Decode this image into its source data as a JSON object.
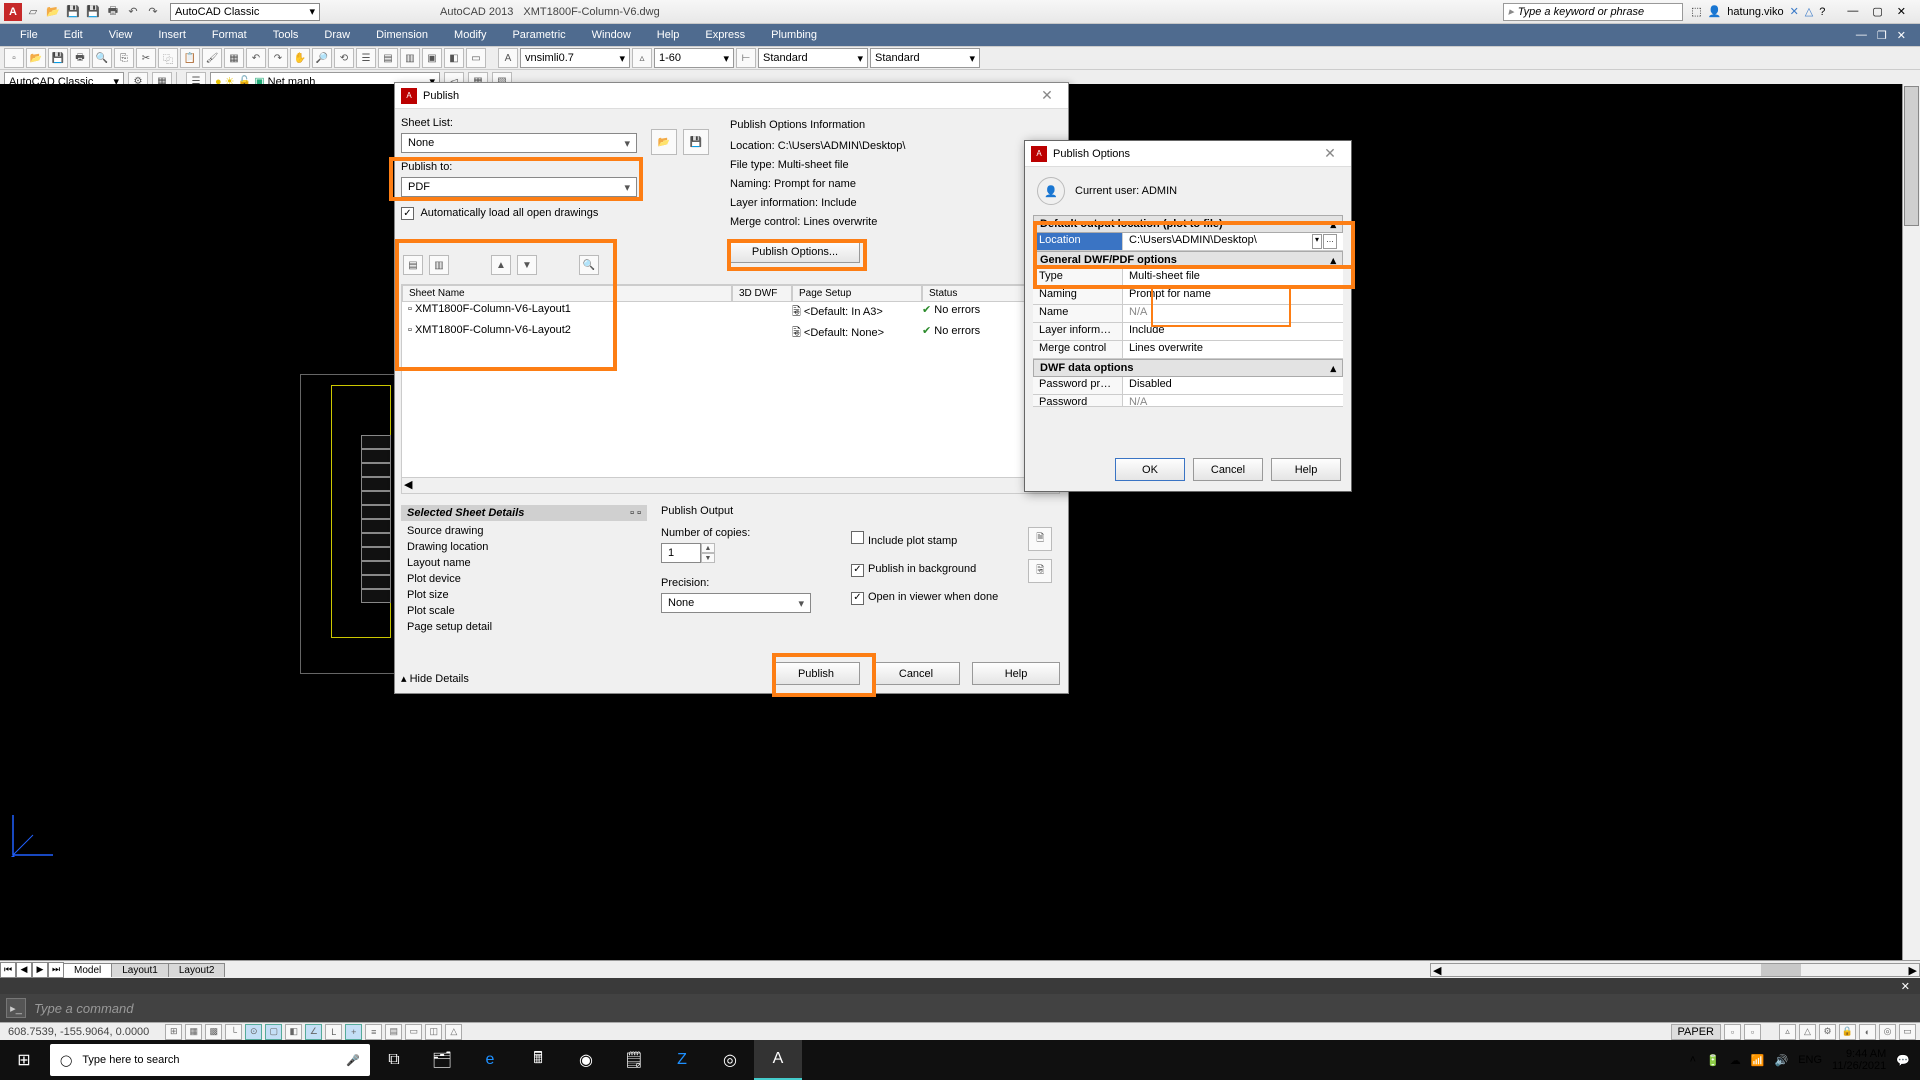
{
  "app": {
    "name": "AutoCAD 2013",
    "file": "XMT1800F-Column-V6.dwg",
    "workspace": "AutoCAD Classic",
    "search_placeholder": "Type a keyword or phrase",
    "user": "hatung.viko"
  },
  "menus": [
    "File",
    "Edit",
    "View",
    "Insert",
    "Format",
    "Tools",
    "Draw",
    "Dimension",
    "Modify",
    "Parametric",
    "Window",
    "Help",
    "Express",
    "Plumbing"
  ],
  "toolbar1": {
    "textstyle": "vnsimli0.7",
    "annoscale": "1-60",
    "dimstyle": "Standard",
    "tablestyle": "Standard"
  },
  "toolbar2": {
    "layer": "Net manh",
    "ws": "AutoCAD Classic"
  },
  "tabs": {
    "items": [
      "Model",
      "Layout1",
      "Layout2"
    ],
    "active": 0
  },
  "cmd": {
    "placeholder": "Type a command"
  },
  "status": {
    "coords": "608.7539, -155.9064, 0.0000",
    "paper": "PAPER"
  },
  "publish": {
    "title": "Publish",
    "sheet_list_label": "Sheet List:",
    "sheet_list_value": "None",
    "publish_to_label": "Publish to:",
    "publish_to_value": "PDF",
    "auto_load": "Automatically load all open drawings",
    "info_title": "Publish Options Information",
    "info": {
      "location_label": "Location:",
      "location": "C:\\Users\\ADMIN\\Desktop\\",
      "filetype_label": "File type:",
      "filetype": "Multi-sheet file",
      "naming_label": "Naming:",
      "naming": "Prompt for name",
      "layer_label": "Layer information:",
      "layer": "Include",
      "merge_label": "Merge control:",
      "merge": "Lines overwrite"
    },
    "options_btn": "Publish Options...",
    "columns": {
      "sheet": "Sheet Name",
      "dwf": "3D DWF",
      "page": "Page Setup",
      "status": "Status"
    },
    "rows": [
      {
        "name": "XMT1800F-Column-V6-Layout1",
        "page": "<Default: In A3>",
        "status": "No errors"
      },
      {
        "name": "XMT1800F-Column-V6-Layout2",
        "page": "<Default: None>",
        "status": "No errors"
      }
    ],
    "details_title": "Selected Sheet Details",
    "details": [
      "Source drawing",
      "Drawing location",
      "Layout name",
      "Plot device",
      "Plot size",
      "Plot scale",
      "Page setup detail"
    ],
    "hide_details": "Hide Details",
    "output_title": "Publish Output",
    "copies_label": "Number of copies:",
    "copies_value": "1",
    "precision_label": "Precision:",
    "precision_value": "None",
    "checks": {
      "stamp": "Include plot stamp",
      "bg": "Publish in background",
      "open": "Open in viewer when done"
    },
    "buttons": {
      "publish": "Publish",
      "cancel": "Cancel",
      "help": "Help"
    }
  },
  "options_dlg": {
    "title": "Publish Options",
    "user_label": "Current user:",
    "user": "ADMIN",
    "sections": {
      "output": "Default output location (plot to file)",
      "general": "General DWF/PDF options",
      "dwf": "DWF data options"
    },
    "props": {
      "location_k": "Location",
      "location_v": "C:\\Users\\ADMIN\\Desktop\\",
      "type_k": "Type",
      "type_v": "Multi-sheet file",
      "naming_k": "Naming",
      "naming_v": "Prompt for name",
      "name_k": "Name",
      "name_v": "N/A",
      "layer_k": "Layer informati...",
      "layer_v": "Include",
      "merge_k": "Merge control",
      "merge_v": "Lines overwrite",
      "pwd_k": "Password prote...",
      "pwd_v": "Disabled",
      "pwd2_k": "Password",
      "pwd2_v": "N/A"
    },
    "buttons": {
      "ok": "OK",
      "cancel": "Cancel",
      "help": "Help"
    }
  },
  "taskbar": {
    "search": "Type here to search",
    "lang": "ENG",
    "time": "9:44 AM",
    "date": "11/26/2021"
  }
}
